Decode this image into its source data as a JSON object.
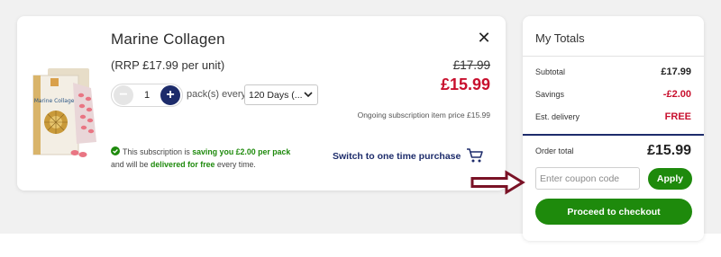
{
  "product": {
    "title": "Marine Collagen",
    "close_icon": "close-icon",
    "rrp": "(RRP £17.99 per unit)",
    "old_price": "£17.99",
    "new_price": "£15.99",
    "quantity": "1",
    "pack_label": "pack(s) every",
    "frequency": "120 Days (...",
    "ongoing": "Ongoing subscription item price £15.99",
    "info": {
      "part1": "This subscription is ",
      "saving": "saving you £2.00 per pack",
      "part2": "and will be ",
      "delivered": "delivered for free",
      "part3": " every time."
    },
    "switch_label": "Switch to one time purchase",
    "image_label": "Marine Collagen"
  },
  "totals": {
    "title": "My Totals",
    "subtotal_label": "Subtotal",
    "subtotal_value": "£17.99",
    "savings_label": "Savings",
    "savings_value": "-£2.00",
    "delivery_label": "Est. delivery",
    "delivery_value": "FREE",
    "order_total_label": "Order total",
    "order_total_value": "£15.99",
    "coupon_placeholder": "Enter coupon code",
    "apply_label": "Apply",
    "checkout_label": "Proceed to checkout"
  },
  "colors": {
    "accent_green": "#1e8a0c",
    "navy": "#1d2c6b",
    "price_red": "#c8102e",
    "arrow": "#7a1226"
  }
}
